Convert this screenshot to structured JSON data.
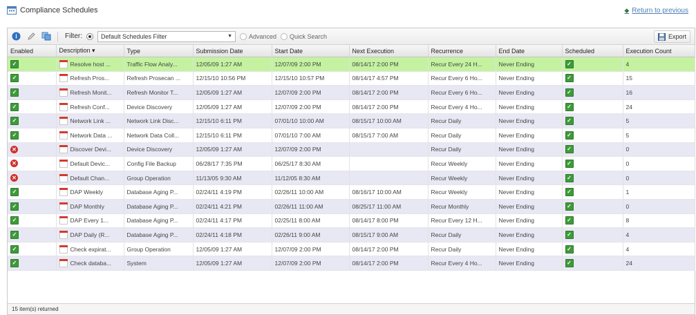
{
  "page": {
    "title": "Compliance Schedules",
    "return_link": "Return to previous"
  },
  "toolbar": {
    "filter_label": "Filter:",
    "filter_selected": "Default Schedules Filter",
    "advanced_label": "Advanced",
    "quick_search_label": "Quick Search",
    "export_label": "Export"
  },
  "columns": [
    "Enabled",
    "Description ▾",
    "Type",
    "Submission Date",
    "Start Date",
    "Next Execution",
    "Recurrence",
    "End Date",
    "Scheduled",
    "Execution Count"
  ],
  "rows": [
    {
      "enabled": true,
      "description": "Resolve host ...",
      "type": "Traffic Flow Analy...",
      "submission": "12/05/09 1:27 AM",
      "start": "12/07/09 2:00 PM",
      "next": "08/14/17 2:00 PM",
      "recurrence": "Recur Every 24 H...",
      "end": "Never Ending",
      "scheduled": true,
      "count": "4"
    },
    {
      "enabled": true,
      "description": "Refresh Pros...",
      "type": "Refresh Prosecan ...",
      "submission": "12/15/10 10:56 PM",
      "start": "12/15/10 10:57 PM",
      "next": "08/14/17 4:57 PM",
      "recurrence": "Recur Every 6 Ho...",
      "end": "Never Ending",
      "scheduled": true,
      "count": "15"
    },
    {
      "enabled": true,
      "description": "Refresh Monit...",
      "type": "Refresh Monitor T...",
      "submission": "12/05/09 1:27 AM",
      "start": "12/07/09 2:00 PM",
      "next": "08/14/17 2:00 PM",
      "recurrence": "Recur Every 6 Ho...",
      "end": "Never Ending",
      "scheduled": true,
      "count": "16"
    },
    {
      "enabled": true,
      "description": "Refresh Conf...",
      "type": "Device Discovery",
      "submission": "12/05/09 1:27 AM",
      "start": "12/07/09 2:00 PM",
      "next": "08/14/17 2:00 PM",
      "recurrence": "Recur Every 4 Ho...",
      "end": "Never Ending",
      "scheduled": true,
      "count": "24"
    },
    {
      "enabled": true,
      "description": "Network Link ...",
      "type": "Network Link Disc...",
      "submission": "12/15/10 6:11 PM",
      "start": "07/01/10 10:00 AM",
      "next": "08/15/17 10:00 AM",
      "recurrence": "Recur Daily",
      "end": "Never Ending",
      "scheduled": true,
      "count": "5"
    },
    {
      "enabled": true,
      "description": "Network Data ...",
      "type": "Network Data Coll...",
      "submission": "12/15/10 6:11 PM",
      "start": "07/01/10 7:00 AM",
      "next": "08/15/17 7:00 AM",
      "recurrence": "Recur Daily",
      "end": "Never Ending",
      "scheduled": true,
      "count": "5"
    },
    {
      "enabled": false,
      "description": "Discover Devi...",
      "type": "Device Discovery",
      "submission": "12/05/09 1:27 AM",
      "start": "12/07/09 2:00 PM",
      "next": "",
      "recurrence": "Recur Daily",
      "end": "Never Ending",
      "scheduled": true,
      "count": "0"
    },
    {
      "enabled": false,
      "description": "Default Devic...",
      "type": "Config File Backup",
      "submission": "06/28/17 7:35 PM",
      "start": "06/25/17 8:30 AM",
      "next": "",
      "recurrence": "Recur Weekly",
      "end": "Never Ending",
      "scheduled": true,
      "count": "0"
    },
    {
      "enabled": false,
      "description": "Default Chan...",
      "type": "Group Operation",
      "submission": "11/13/05 9:30 AM",
      "start": "11/12/05 8:30 AM",
      "next": "",
      "recurrence": "Recur Weekly",
      "end": "Never Ending",
      "scheduled": true,
      "count": "0"
    },
    {
      "enabled": true,
      "description": "DAP Weekly",
      "type": "Database Aging P...",
      "submission": "02/24/11 4:19 PM",
      "start": "02/26/11 10:00 AM",
      "next": "08/16/17 10:00 AM",
      "recurrence": "Recur Weekly",
      "end": "Never Ending",
      "scheduled": true,
      "count": "1"
    },
    {
      "enabled": true,
      "description": "DAP Monthly",
      "type": "Database Aging P...",
      "submission": "02/24/11 4:21 PM",
      "start": "02/26/11 11:00 AM",
      "next": "08/25/17 11:00 AM",
      "recurrence": "Recur Monthly",
      "end": "Never Ending",
      "scheduled": true,
      "count": "0"
    },
    {
      "enabled": true,
      "description": "DAP Every 1...",
      "type": "Database Aging P...",
      "submission": "02/24/11 4:17 PM",
      "start": "02/25/11 8:00 AM",
      "next": "08/14/17 8:00 PM",
      "recurrence": "Recur Every 12 H...",
      "end": "Never Ending",
      "scheduled": true,
      "count": "8"
    },
    {
      "enabled": true,
      "description": "DAP Daily (R...",
      "type": "Database Aging P...",
      "submission": "02/24/11 4:18 PM",
      "start": "02/26/11 9:00 AM",
      "next": "08/15/17 9:00 AM",
      "recurrence": "Recur Daily",
      "end": "Never Ending",
      "scheduled": true,
      "count": "4"
    },
    {
      "enabled": true,
      "description": "Check expirat...",
      "type": "Group Operation",
      "submission": "12/05/09 1:27 AM",
      "start": "12/07/09 2:00 PM",
      "next": "08/14/17 2:00 PM",
      "recurrence": "Recur Daily",
      "end": "Never Ending",
      "scheduled": true,
      "count": "4"
    },
    {
      "enabled": true,
      "description": "Check databa...",
      "type": "System",
      "submission": "12/05/09 1:27 AM",
      "start": "12/07/09 2:00 PM",
      "next": "08/14/17 2:00 PM",
      "recurrence": "Recur Every 4 Ho...",
      "end": "Never Ending",
      "scheduled": true,
      "count": "24"
    }
  ],
  "status": {
    "returned": "15 item(s) returned"
  },
  "colors": {
    "selected_row": "#c4f2a0",
    "alt_row": "#e8e8f4",
    "link": "#4a7fb5",
    "enabled_check": "#3f9a3a",
    "disabled_x": "#d0302a"
  },
  "icons": {
    "title": "schedule-icon",
    "help": "help-icon",
    "edit": "edit-icon",
    "copy": "copy-icon",
    "export": "save-disk-icon",
    "return": "back-arrow-icon",
    "enabled": "check-icon",
    "disabled": "disabled-x-icon",
    "description": "calendar-icon"
  }
}
